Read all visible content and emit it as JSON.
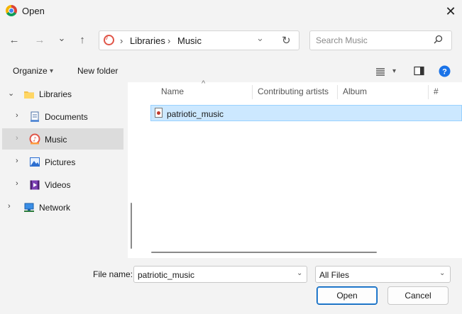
{
  "window": {
    "title": "Open",
    "close_glyph": "✕"
  },
  "nav": {
    "back": "←",
    "forward": "→",
    "recent": "⌄",
    "up": "↑",
    "refresh": "↻"
  },
  "address": {
    "crumbs": [
      "Libraries",
      "Music"
    ],
    "separator": "›",
    "dropdown": "⌄"
  },
  "search": {
    "placeholder": "Search Music"
  },
  "toolbar": {
    "organize": "Organize",
    "new_folder": "New folder",
    "dropdown": "▾"
  },
  "sidebar": {
    "items": [
      {
        "label": "Libraries",
        "chevron": "⌄",
        "icon": "folder-icon"
      },
      {
        "label": "Documents",
        "chevron": "›",
        "icon": "documents-icon"
      },
      {
        "label": "Music",
        "chevron": "›",
        "icon": "music-icon",
        "selected": true
      },
      {
        "label": "Pictures",
        "chevron": "›",
        "icon": "pictures-icon"
      },
      {
        "label": "Videos",
        "chevron": "›",
        "icon": "videos-icon"
      },
      {
        "label": "Network",
        "chevron": "›",
        "icon": "network-icon"
      }
    ]
  },
  "columns": {
    "name": "Name",
    "artists": "Contributing artists",
    "album": "Album",
    "number": "#",
    "sort_glyph": "^"
  },
  "files": [
    {
      "name": "patriotic_music",
      "selected": true
    }
  ],
  "footer": {
    "filename_label": "File name:",
    "filename_value": "patriotic_music",
    "filter_value": "All Files",
    "open_label": "Open",
    "cancel_label": "Cancel"
  },
  "colors": {
    "accent": "#005fb8",
    "selection": "#cce8ff",
    "chrome": "#f3f3f3"
  }
}
